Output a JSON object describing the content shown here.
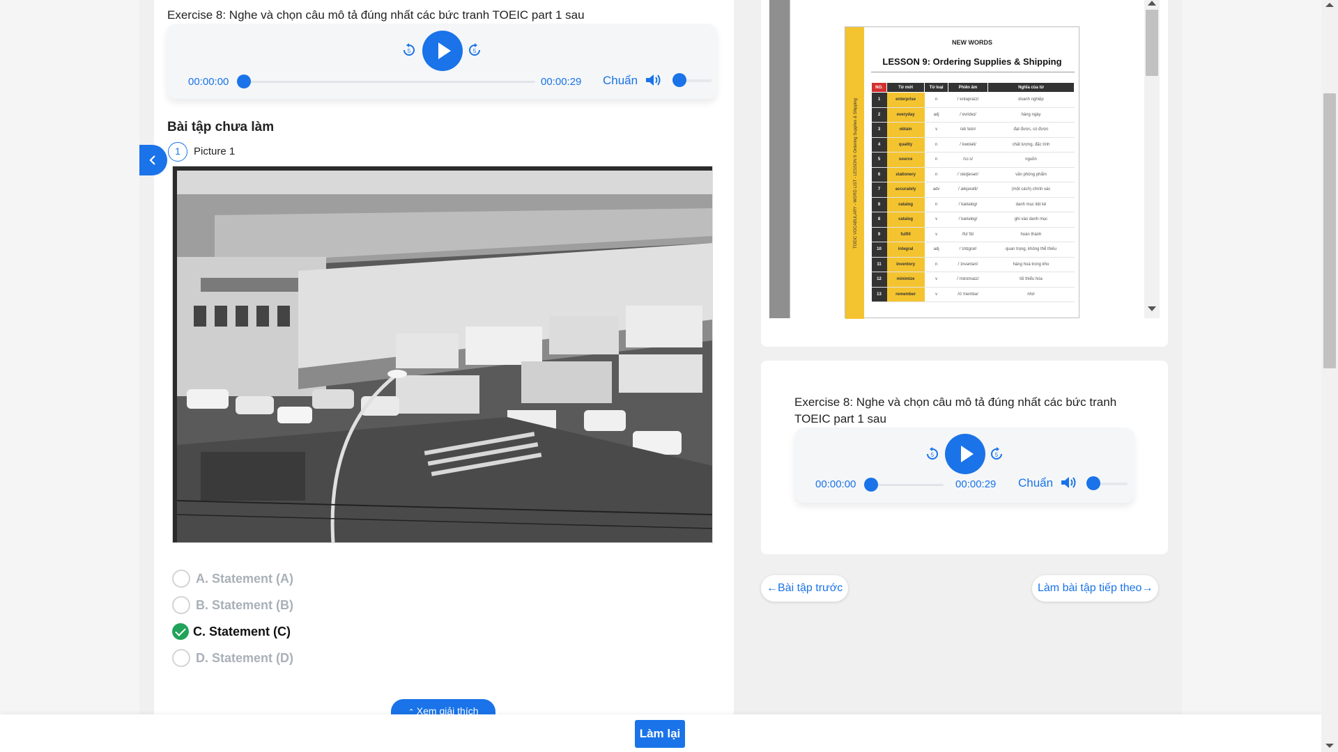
{
  "left_exercise": {
    "title": "Exercise 8: Nghe và chọn câu mô tả đúng nhất các bức tranh TOEIC part 1 sau",
    "player": {
      "current_time": "00:00:00",
      "duration": "00:00:29",
      "speed": "Chuẩn",
      "progress": 0,
      "volume": 0
    }
  },
  "section_title": "Bài tập chưa làm",
  "question": {
    "number": "1",
    "label": "Picture 1"
  },
  "options": [
    {
      "label": "A. Statement (A)",
      "selected": false
    },
    {
      "label": "B. Statement (B)",
      "selected": false
    },
    {
      "label": "C. Statement (C)",
      "selected": true
    },
    {
      "label": "D. Statement (D)",
      "selected": false
    }
  ],
  "explain_button": "Xem giải thích",
  "redo_button": "Làm lại",
  "lesson_sheet": {
    "header": "NEW WORDS",
    "title": "LESSON 9: Ordering Supplies & Shipping",
    "side_text": "TOEIC VOCABULARY - WORD LIST - LESSON 9: Ordering Supplies & Shipping",
    "columns": [
      "NO.",
      "Từ mới",
      "Từ loại",
      "Phiên âm",
      "Nghĩa của từ"
    ],
    "rows": [
      [
        "1",
        "enterprise",
        "n",
        "/ˈentəpraɪz/",
        "doanh nghiệp"
      ],
      [
        "2",
        "everyday",
        "adj",
        "/ˈevrideɪ/",
        "hàng ngày"
      ],
      [
        "3",
        "obtain",
        "v",
        "/əbˈteɪn/",
        "đạt được, có được"
      ],
      [
        "4",
        "quality",
        "n",
        "/ˈkwɒləti/",
        "chất lượng, đặc tính"
      ],
      [
        "5",
        "source",
        "n",
        "/sɔːs/",
        "nguồn"
      ],
      [
        "6",
        "stationery",
        "n",
        "/ˈsteɪʃənəri/",
        "văn phòng phẩm"
      ],
      [
        "7",
        "accurately",
        "adv",
        "/ˈækjərətli/",
        "(một cách) chính xác"
      ],
      [
        "8",
        "catalog",
        "n",
        "/ˈkætəlɒɡ/",
        "danh mục liệt kê"
      ],
      [
        "8",
        "catalog",
        "v",
        "/ˈkætəlɒɡ/",
        "ghi vào danh mục"
      ],
      [
        "9",
        "fulfill",
        "v",
        "/fʊlˈfɪl/",
        "hoàn thành"
      ],
      [
        "10",
        "integral",
        "adj",
        "/ˈɪntɪɡrəl/",
        "quan trọng, không thể thiếu"
      ],
      [
        "11",
        "inventory",
        "n",
        "/ˈɪnvəntəri/",
        "hàng hoá trong kho"
      ],
      [
        "12",
        "minimize",
        "v",
        "/ˈmɪnɪmaɪz/",
        "tối thiểu hóa"
      ],
      [
        "13",
        "remember",
        "v",
        "/rɪˈmembə/",
        "nhớ"
      ]
    ]
  },
  "right_exercise": {
    "title_line1": "Exercise 8: Nghe và chọn câu mô tả đúng nhất các bức tranh",
    "title_line2": "TOEIC part 1 sau",
    "player": {
      "current_time": "00:00:00",
      "duration": "00:00:29",
      "speed": "Chuẩn",
      "progress": 0,
      "volume": 0
    }
  },
  "nav": {
    "prev": "←Bài tập trước",
    "next": "Làm bài tập tiếp theo→"
  },
  "colors": {
    "accent": "#1a73e8",
    "success": "#22a35a",
    "sheet_yellow": "#f4c430"
  }
}
